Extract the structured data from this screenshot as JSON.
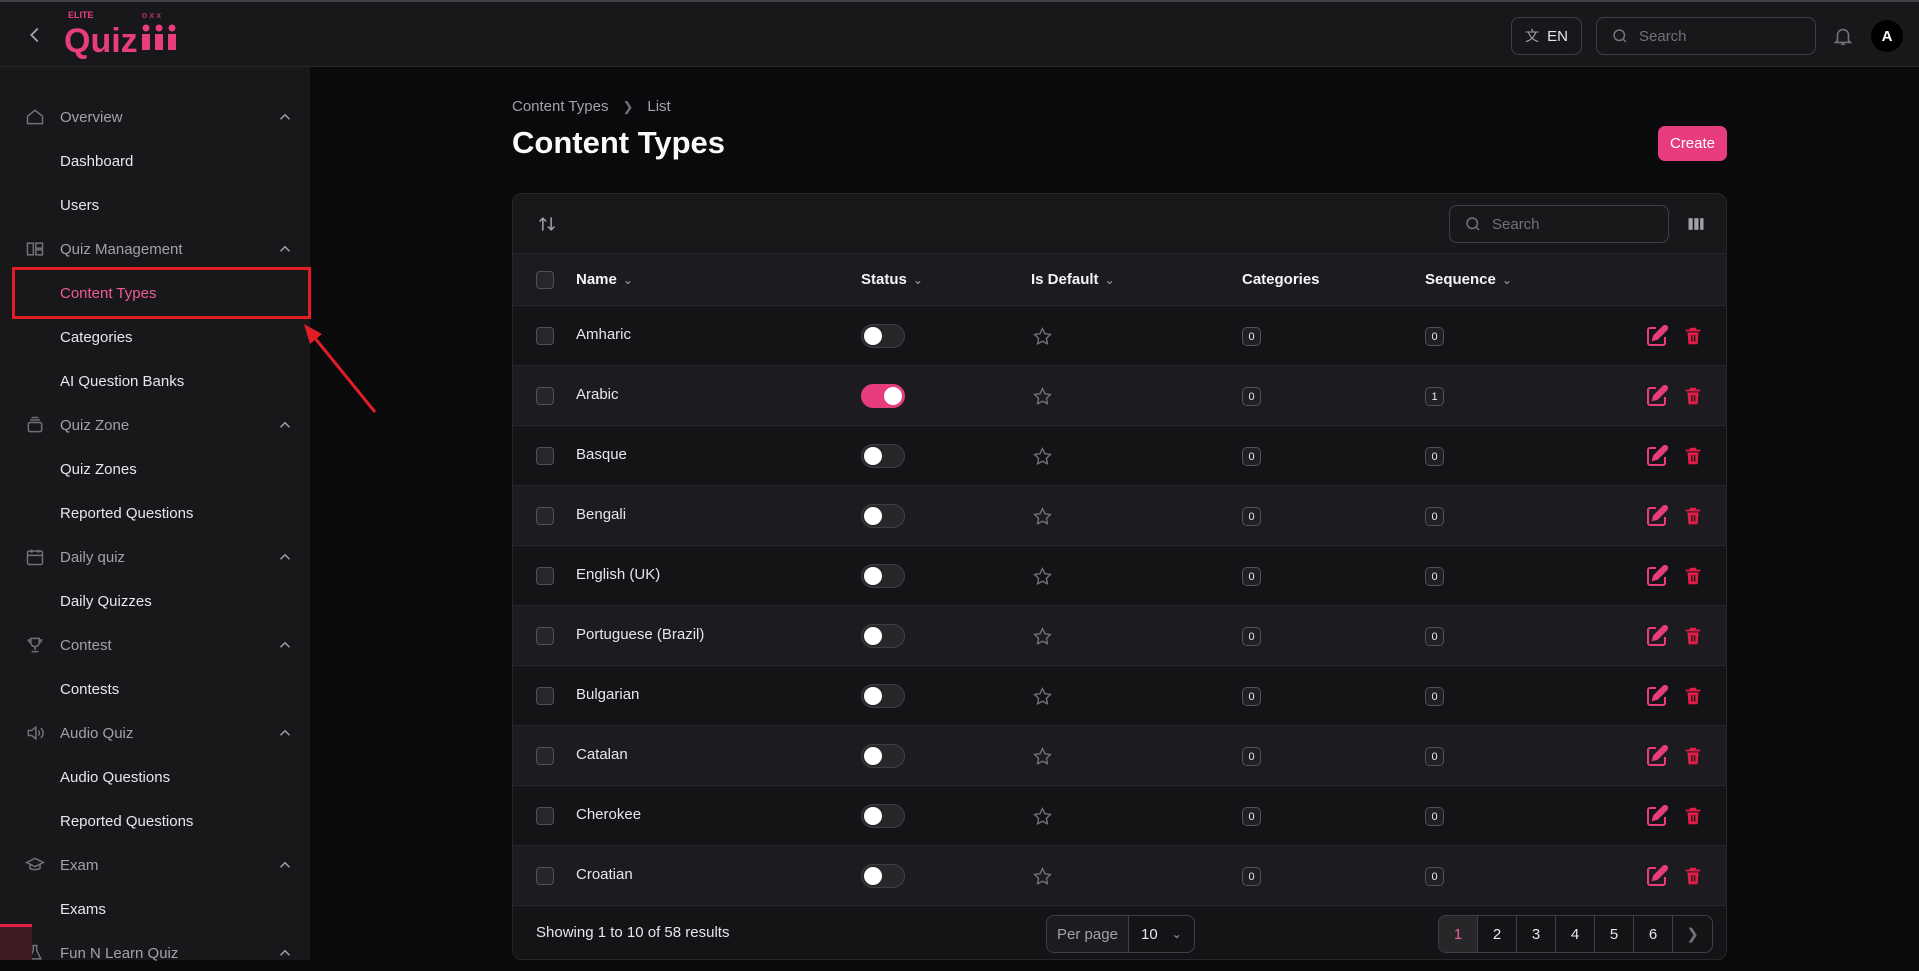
{
  "header": {
    "logo_text": "ELITE Quiz",
    "language": "EN",
    "search_placeholder": "Search",
    "avatar_initial": "A"
  },
  "sidebar": {
    "groups": [
      {
        "label": "Overview",
        "icon": "home-icon",
        "items": [
          "Dashboard",
          "Users"
        ]
      },
      {
        "label": "Quiz Management",
        "icon": "layout-icon",
        "items": [
          "Content Types",
          "Categories",
          "AI Question Banks"
        ]
      },
      {
        "label": "Quiz Zone",
        "icon": "stack-icon",
        "items": [
          "Quiz Zones",
          "Reported Questions"
        ]
      },
      {
        "label": "Daily quiz",
        "icon": "calendar-icon",
        "items": [
          "Daily Quizzes"
        ]
      },
      {
        "label": "Contest",
        "icon": "trophy-icon",
        "items": [
          "Contests"
        ]
      },
      {
        "label": "Audio Quiz",
        "icon": "speaker-icon",
        "items": [
          "Audio Questions",
          "Reported Questions"
        ]
      },
      {
        "label": "Exam",
        "icon": "graduation-cap-icon",
        "items": [
          "Exams"
        ]
      },
      {
        "label": "Fun N Learn Quiz",
        "icon": "flask-icon",
        "items": []
      }
    ],
    "active_item": "Content Types"
  },
  "breadcrumb": [
    "Content Types",
    "List"
  ],
  "page_title": "Content Types",
  "create_label": "Create",
  "table": {
    "search_placeholder": "Search",
    "columns": [
      "Name",
      "Status",
      "Is Default",
      "Categories",
      "Sequence"
    ],
    "rows": [
      {
        "name": "Amharic",
        "status": false,
        "categories": "0",
        "sequence": "0"
      },
      {
        "name": "Arabic",
        "status": true,
        "categories": "0",
        "sequence": "1"
      },
      {
        "name": "Basque",
        "status": false,
        "categories": "0",
        "sequence": "0"
      },
      {
        "name": "Bengali",
        "status": false,
        "categories": "0",
        "sequence": "0"
      },
      {
        "name": "English (UK)",
        "status": false,
        "categories": "0",
        "sequence": "0"
      },
      {
        "name": "Portuguese (Brazil)",
        "status": false,
        "categories": "0",
        "sequence": "0"
      },
      {
        "name": "Bulgarian",
        "status": false,
        "categories": "0",
        "sequence": "0"
      },
      {
        "name": "Catalan",
        "status": false,
        "categories": "0",
        "sequence": "0"
      },
      {
        "name": "Cherokee",
        "status": false,
        "categories": "0",
        "sequence": "0"
      },
      {
        "name": "Croatian",
        "status": false,
        "categories": "0",
        "sequence": "0"
      }
    ],
    "showing": "Showing 1 to 10 of 58 results",
    "per_page_label": "Per page",
    "per_page_value": "10",
    "pages": [
      "1",
      "2",
      "3",
      "4",
      "5",
      "6"
    ],
    "current_page": "1"
  },
  "colors": {
    "accent": "#e73c7e",
    "danger": "#e11d48",
    "highlight": "#e11d26"
  }
}
